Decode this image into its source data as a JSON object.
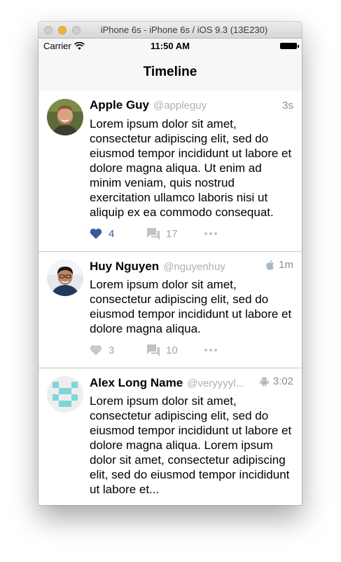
{
  "window": {
    "title": "iPhone 6s - iPhone 6s / iOS 9.3 (13E230)"
  },
  "status_bar": {
    "carrier": "Carrier",
    "time": "11:50 AM"
  },
  "nav": {
    "title": "Timeline"
  },
  "colors": {
    "like_active": "#3b5998",
    "muted": "#a5a5a5",
    "separator": "#c8c7cc"
  },
  "tweets": [
    {
      "name": "Apple Guy",
      "handle": "@appleguy",
      "time": "3s",
      "platform_icon": "",
      "body": "Lorem ipsum dolor sit amet, consectetur adipiscing elit, sed do eiusmod tempor incididunt ut labore et dolore magna aliqua. Ut enim ad minim veniam, quis nostrud exercitation ullamco laboris nisi ut aliquip ex ea commodo consequat.",
      "likes": "4",
      "liked": true,
      "comments": "17"
    },
    {
      "name": "Huy Nguyen",
      "handle": "@nguyenhuy",
      "time": "1m",
      "platform_icon": "apple-icon",
      "body": "Lorem ipsum dolor sit amet, consectetur adipiscing elit, sed do eiusmod tempor incididunt ut labore et dolore magna aliqua.",
      "likes": "3",
      "liked": false,
      "comments": "10"
    },
    {
      "name": "Alex Long Name",
      "handle": "@veryyyyl...",
      "time": "3:02",
      "platform_icon": "android-icon",
      "body": "Lorem ipsum dolor sit amet, consectetur adipiscing elit, sed do eiusmod tempor incididunt ut labore et dolore magna aliqua. Lorem ipsum dolor sit amet, consectetur adipiscing elit, sed do eiusmod tempor incididunt ut labore et..."
    }
  ]
}
